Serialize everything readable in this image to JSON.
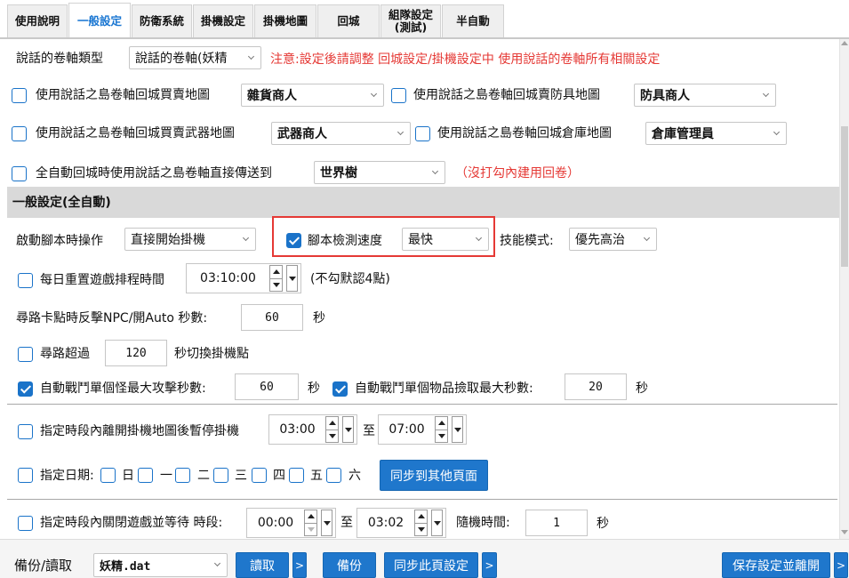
{
  "tabs": [
    {
      "label": "使用說明"
    },
    {
      "label": "一般設定"
    },
    {
      "label": "防衛系統"
    },
    {
      "label": "掛機設定"
    },
    {
      "label": "掛機地圖"
    },
    {
      "label": "回城"
    },
    {
      "label_line1": "組隊設定",
      "label_line2": "(測試)"
    },
    {
      "label": "半自動"
    }
  ],
  "scroll": {
    "scroll_type_label": "說話的卷軸類型",
    "scroll_type_value": "說話的卷軸(妖精",
    "warning": "注意:設定後請調整 回城設定/掛機設定中 使用說話的卷軸所有相關設定",
    "general_store_label": "使用說話之島卷軸回城買賣地圖",
    "general_store_value": "雜貨商人",
    "armor_store_label": "使用說話之島卷軸回城賣防具地圖",
    "armor_store_value": "防具商人",
    "weapon_store_label": "使用說話之島卷軸回城買賣武器地圖",
    "weapon_store_value": "武器商人",
    "warehouse_label": "使用說話之島卷軸回城倉庫地圖",
    "warehouse_value": "倉庫管理員",
    "direct_teleport_label": "全自動回城時使用說話之島卷軸直接傳送到",
    "direct_teleport_value": "世界樹",
    "direct_teleport_note": "（沒打勾內建用回卷）"
  },
  "general": {
    "section_title": "一般設定(全自動)",
    "start_action_label": "啟動腳本時操作",
    "start_action_value": "直接開始掛機",
    "script_speed_label": "腳本檢測速度",
    "script_speed_value": "最快",
    "skill_mode_label": "技能模式:",
    "skill_mode_value": "優先高治",
    "daily_reset_label": "每日重置遊戲排程時間",
    "daily_reset_time": "03:10:00",
    "daily_reset_note": "(不勾默認4點)",
    "stuck_label": "尋路卡點時反擊NPC/開Auto 秒數:",
    "stuck_value": "60",
    "sec_unit": "秒",
    "path_timeout_label": "尋路超過",
    "path_timeout_value": "120",
    "path_timeout_suffix": "秒切換掛機點",
    "max_attack_label": "自動戰鬥單個怪最大攻擊秒數:",
    "max_attack_value": "60",
    "max_pickup_label": "自動戰鬥單個物品撿取最大秒數:",
    "max_pickup_value": "20"
  },
  "schedule": {
    "pause_label": "指定時段內離開掛機地圖後暫停掛機",
    "pause_from": "03:00",
    "to_label": "至",
    "pause_to": "07:00",
    "date_label": "指定日期:",
    "days": [
      "日",
      "一",
      "二",
      "三",
      "四",
      "五",
      "六"
    ],
    "sync_other_button": "同步到其他頁面",
    "close_label": "指定時段內關閉遊戲並等待 時段:",
    "close_from": "00:00",
    "close_to": "03:02",
    "random_label": "隨機時間:",
    "random_value": "1",
    "random_unit": "秒"
  },
  "bottom": {
    "backup_label": "備份/讀取",
    "profile_value": "妖精.dat",
    "load_button": "讀取",
    "more_glyph": ">",
    "backup_button": "備份",
    "sync_page_button": "同步此頁設定",
    "save_exit_button": "保存設定並離開"
  },
  "colors": {
    "accent": "#1976d2",
    "warning": "#e53935",
    "button": "#1f77cc"
  }
}
